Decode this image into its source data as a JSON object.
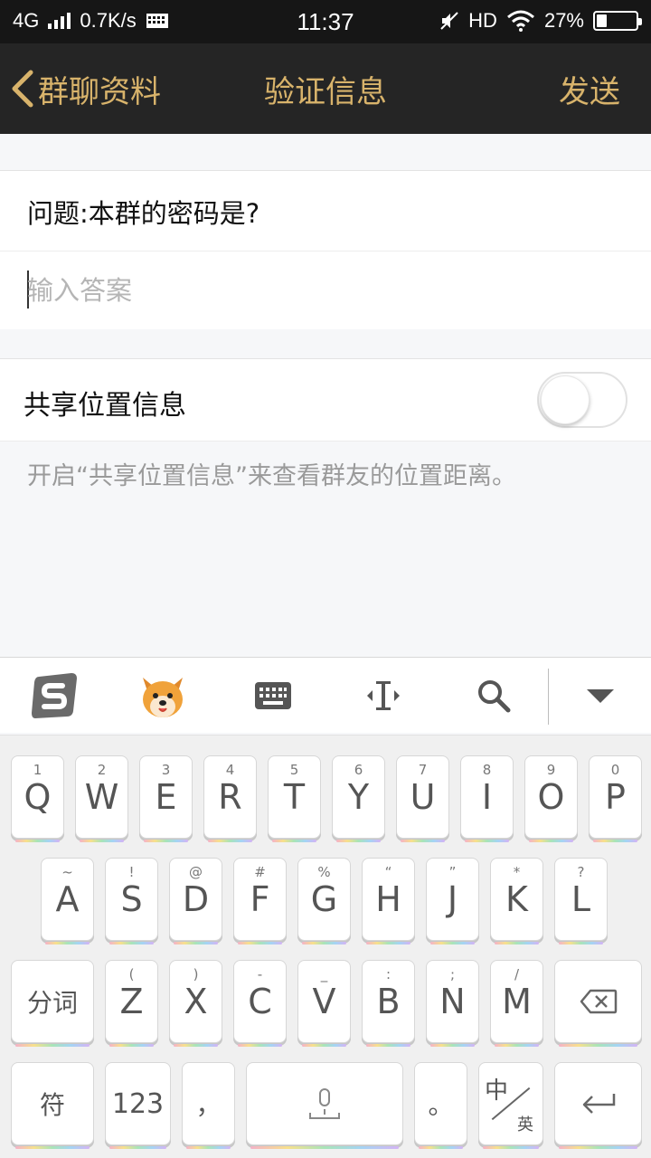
{
  "status_bar": {
    "network": "4G",
    "speed": "0.7K/s",
    "time": "11:37",
    "hd": "HD",
    "battery": "27%",
    "battery_level": 0.27
  },
  "nav": {
    "back_label": "群聊资料",
    "title": "验证信息",
    "send_label": "发送"
  },
  "form": {
    "question": "问题:本群的密码是?",
    "answer_value": "",
    "answer_placeholder": "输入答案"
  },
  "share": {
    "label": "共享位置信息",
    "enabled": false,
    "hint": "开启“共享位置信息”来查看群友的位置距离。"
  },
  "keyboard_toolbar": {
    "icons": [
      "sogou-logo-icon",
      "emoji-dog-icon",
      "keyboard-icon",
      "cursor-icon",
      "search-icon",
      "collapse-keyboard-icon"
    ]
  },
  "keyboard": {
    "row1": [
      {
        "main": "Q",
        "sub": "1"
      },
      {
        "main": "W",
        "sub": "2"
      },
      {
        "main": "E",
        "sub": "3"
      },
      {
        "main": "R",
        "sub": "4"
      },
      {
        "main": "T",
        "sub": "5"
      },
      {
        "main": "Y",
        "sub": "6"
      },
      {
        "main": "U",
        "sub": "7"
      },
      {
        "main": "I",
        "sub": "8"
      },
      {
        "main": "O",
        "sub": "9"
      },
      {
        "main": "P",
        "sub": "0"
      }
    ],
    "row2": [
      {
        "main": "A",
        "sub": "~"
      },
      {
        "main": "S",
        "sub": "!"
      },
      {
        "main": "D",
        "sub": "@"
      },
      {
        "main": "F",
        "sub": "#"
      },
      {
        "main": "G",
        "sub": "%"
      },
      {
        "main": "H",
        "sub": "“"
      },
      {
        "main": "J",
        "sub": "”"
      },
      {
        "main": "K",
        "sub": "*"
      },
      {
        "main": "L",
        "sub": "?"
      }
    ],
    "row3": [
      {
        "main": "Z",
        "sub": "("
      },
      {
        "main": "X",
        "sub": ")"
      },
      {
        "main": "C",
        "sub": "-"
      },
      {
        "main": "V",
        "sub": "_"
      },
      {
        "main": "B",
        "sub": ":"
      },
      {
        "main": "N",
        "sub": ";"
      },
      {
        "main": "M",
        "sub": "/"
      }
    ],
    "fenci": "分词",
    "fu": "符",
    "num": "123",
    "comma": "，",
    "period": "。",
    "zh": "中",
    "en": "英"
  }
}
